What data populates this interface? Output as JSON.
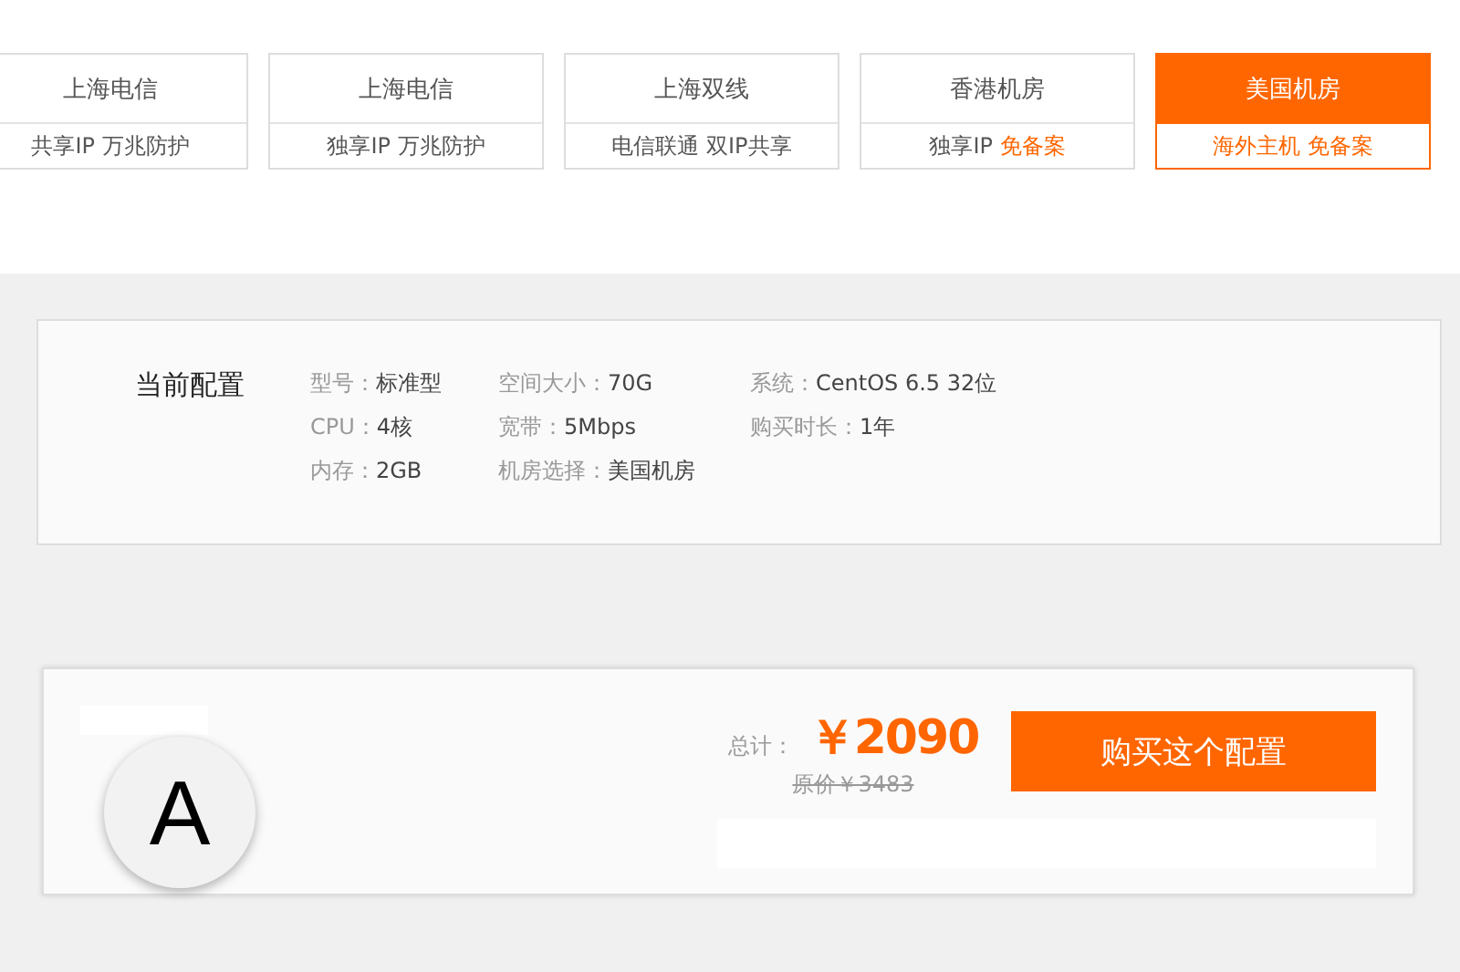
{
  "tabs": [
    {
      "title": "上海电信",
      "sub": [
        {
          "text": "共享IP 万兆防护",
          "highlight": false
        }
      ],
      "selected": false
    },
    {
      "title": "上海电信",
      "sub": [
        {
          "text": "独享IP 万兆防护",
          "highlight": false
        }
      ],
      "selected": false
    },
    {
      "title": "上海双线",
      "sub": [
        {
          "text": "电信联通 双IP共享",
          "highlight": false
        }
      ],
      "selected": false
    },
    {
      "title": "香港机房",
      "sub": [
        {
          "text": "独享IP ",
          "highlight": false
        },
        {
          "text": "免备案",
          "highlight": true
        }
      ],
      "selected": false
    },
    {
      "title": "美国机房",
      "sub": [
        {
          "text": "海外主机 免备案",
          "highlight": true
        }
      ],
      "selected": true
    }
  ],
  "config": {
    "title": "当前配置",
    "columns": [
      [
        {
          "label": "型号：",
          "value": "标准型"
        },
        {
          "label": "CPU：",
          "value": "4核"
        },
        {
          "label": "内存：",
          "value": "2GB"
        }
      ],
      [
        {
          "label": "空间大小：",
          "value": "70G"
        },
        {
          "label": "宽带：",
          "value": "5Mbps"
        },
        {
          "label": "机房选择：",
          "value": "美国机房"
        }
      ],
      [
        {
          "label": "系统：",
          "value": "CentOS 6.5 32位"
        },
        {
          "label": "购买时长：",
          "value": "1年"
        }
      ]
    ]
  },
  "order": {
    "total_label": "总计：",
    "price": "￥2090",
    "original_price": "原价￥3483",
    "buy_button": "购买这个配置",
    "avatar": "A"
  }
}
